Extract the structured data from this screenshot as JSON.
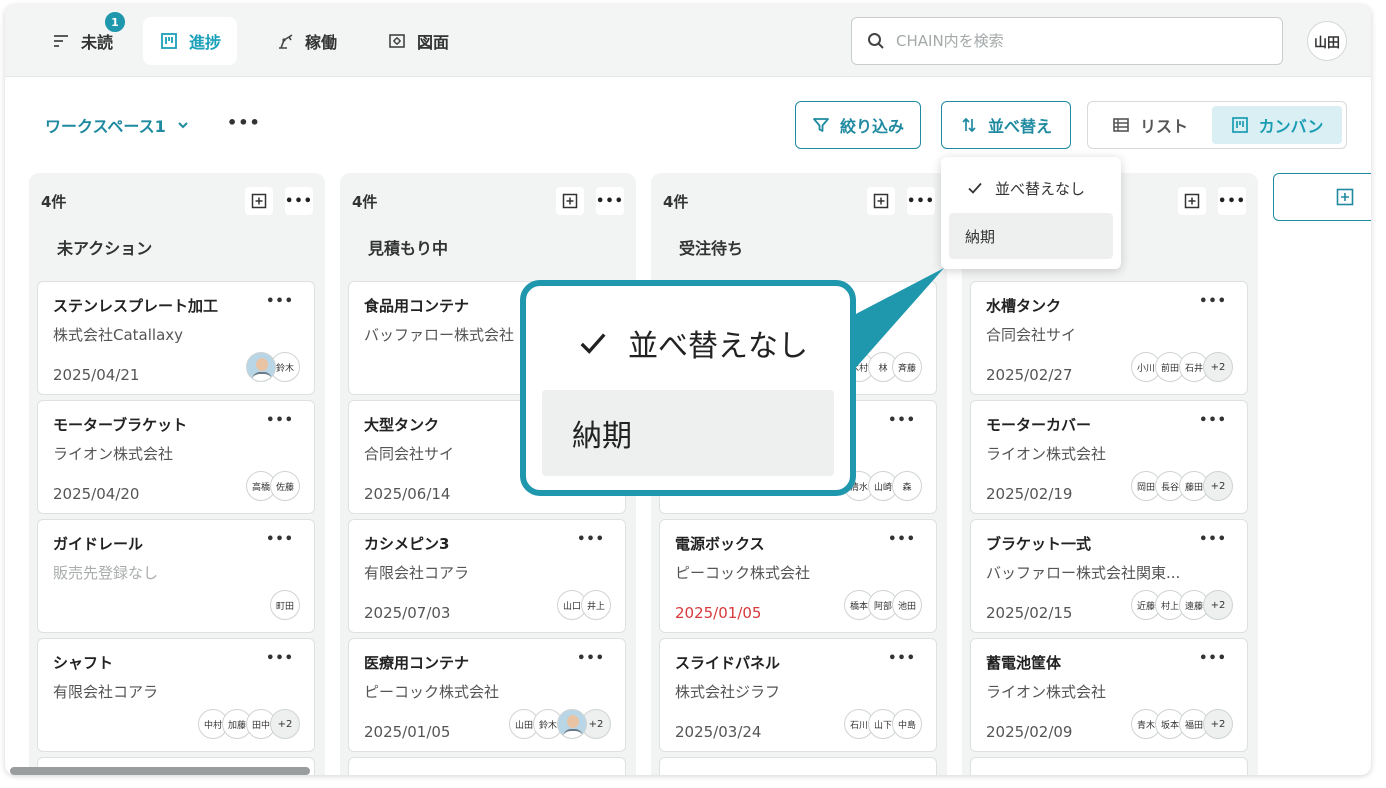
{
  "nav": {
    "tabs": [
      {
        "label": "未読",
        "icon": "filter-lines-icon",
        "badge": "1"
      },
      {
        "label": "進捗",
        "icon": "kanban-icon",
        "active": true
      },
      {
        "label": "稼働",
        "icon": "robot-arm-icon"
      },
      {
        "label": "図面",
        "icon": "drawing-icon"
      }
    ],
    "search_placeholder": "CHAIN内を検索",
    "user": "山田"
  },
  "toolbar": {
    "workspace": "ワークスペース1",
    "more": "•••",
    "filter": "絞り込み",
    "sort": "並べ替え",
    "view_list": "リスト",
    "view_kanban": "カンバン"
  },
  "dropdown": {
    "items": [
      "並べ替えなし",
      "納期"
    ],
    "selected": "並べ替えなし",
    "hovered": "納期"
  },
  "columns": [
    {
      "count": "4件",
      "title": "未アクション",
      "cards": [
        {
          "title": "ステンレスプレート加工",
          "company": "株式会社Catallaxy",
          "date": "2025/04/21",
          "avatars": [
            "photo",
            "鈴木"
          ]
        },
        {
          "title": "モーターブラケット",
          "company": "ライオン株式会社",
          "date": "2025/04/20",
          "avatars": [
            "高橋",
            "佐藤"
          ]
        },
        {
          "title": "ガイドレール",
          "company": "販売先登録なし",
          "date": "",
          "avatars": [
            "町田"
          ],
          "muted": true
        },
        {
          "title": "シャフト",
          "company": "有限会社コアラ",
          "date": "",
          "avatars": [
            "中村",
            "加藤",
            "田中",
            "+2"
          ]
        }
      ]
    },
    {
      "count": "4件",
      "title": "見積もり中",
      "cards": [
        {
          "title": "食品用コンテナ",
          "company": "バッファロー株式会社",
          "date": "",
          "avatars": []
        },
        {
          "title": "大型タンク",
          "company": "合同会社サイ",
          "date": "2025/06/14",
          "avatars": []
        },
        {
          "title": "カシメピン3",
          "company": "有限会社コアラ",
          "date": "2025/07/03",
          "avatars": [
            "山口",
            "井上"
          ]
        },
        {
          "title": "医療用コンテナ",
          "company": "ピーコック株式会社",
          "date": "2025/01/05",
          "avatars": [
            "山田",
            "鈴木",
            "photo",
            "+2"
          ]
        }
      ]
    },
    {
      "count": "4件",
      "title": "受注待ち",
      "cards": [
        {
          "title": "",
          "company": "",
          "date": "",
          "avatars": [
            "木村",
            "林",
            "斉藤"
          ]
        },
        {
          "title": "",
          "company": "",
          "date": "",
          "avatars": [
            "清水",
            "山崎",
            "森"
          ]
        },
        {
          "title": "電源ボックス",
          "company": "ピーコック株式会社",
          "date": "2025/01/05",
          "avatars": [
            "橋本",
            "阿部",
            "池田"
          ],
          "overdue": true
        },
        {
          "title": "スライドパネル",
          "company": "株式会社ジラフ",
          "date": "2025/03/24",
          "avatars": [
            "石川",
            "山下",
            "中島"
          ]
        }
      ]
    },
    {
      "count": "",
      "title": "",
      "cards": [
        {
          "title": "水槽タンク",
          "company": "合同会社サイ",
          "date": "2025/02/27",
          "avatars": [
            "小川",
            "前田",
            "石井",
            "+2"
          ]
        },
        {
          "title": "モーターカバー",
          "company": "ライオン株式会社",
          "date": "2025/02/19",
          "avatars": [
            "岡田",
            "長谷",
            "藤田",
            "+2"
          ]
        },
        {
          "title": "ブラケット一式",
          "company": "バッファロー株式会社関東...",
          "date": "2025/02/15",
          "avatars": [
            "近藤",
            "村上",
            "遠藤",
            "+2"
          ]
        },
        {
          "title": "蓄電池筐体",
          "company": "ライオン株式会社",
          "date": "2025/02/09",
          "avatars": [
            "青木",
            "坂本",
            "福田",
            "+2"
          ]
        }
      ]
    }
  ],
  "colors": {
    "accent": "#1f8aa0",
    "accent_light": "#d9eff3",
    "overdue": "#d63a3a"
  }
}
